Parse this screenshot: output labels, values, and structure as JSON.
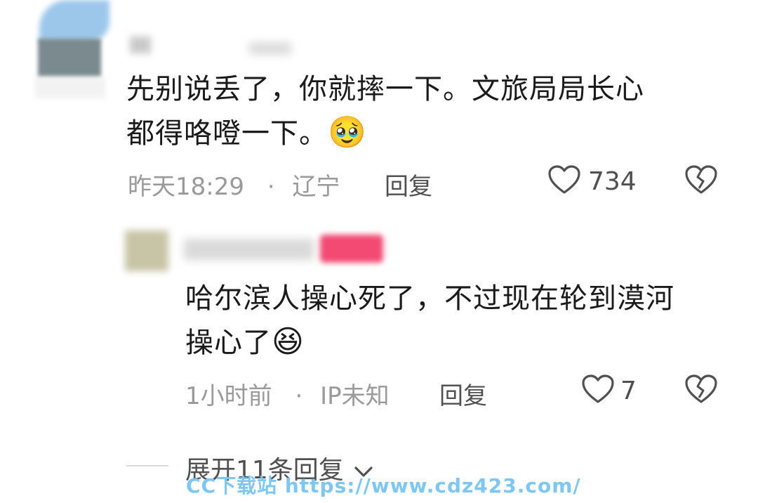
{
  "comment": {
    "text_line1": "先别说丢了，你就摔一下。文旅局局长心",
    "text_line2": "都得咯噔一下。",
    "emoji": "🥹",
    "time": "昨天18:29",
    "separator": "·",
    "location": "辽宁",
    "reply_label": "回复",
    "like_count": "734",
    "icons": {
      "like": "heart-outline-icon",
      "dislike": "broken-heart-icon"
    }
  },
  "reply": {
    "text_line1": "哈尔滨人操心死了，不过现在轮到漠河",
    "text_line2": "操心了",
    "emoji": "😆",
    "time": "1小时前",
    "separator": "·",
    "location": "IP未知",
    "reply_label": "回复",
    "like_count": "7",
    "icons": {
      "like": "heart-outline-icon",
      "dislike": "broken-heart-icon"
    }
  },
  "expand": {
    "label": "展开11条回复",
    "icon": "chevron-down-icon"
  },
  "watermark": {
    "text": "CC下载站  https://www.cdz423.com/"
  }
}
